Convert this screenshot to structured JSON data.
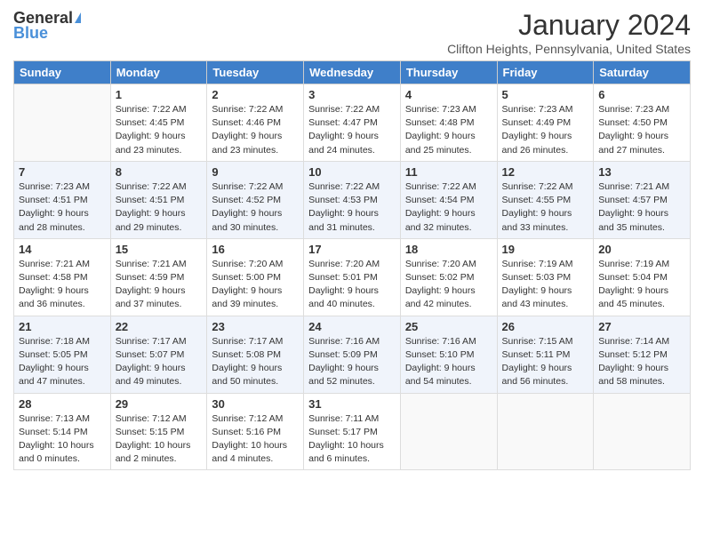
{
  "header": {
    "logo_general": "General",
    "logo_blue": "Blue",
    "month_title": "January 2024",
    "location": "Clifton Heights, Pennsylvania, United States"
  },
  "weekdays": [
    "Sunday",
    "Monday",
    "Tuesday",
    "Wednesday",
    "Thursday",
    "Friday",
    "Saturday"
  ],
  "weeks": [
    [
      {
        "day": "",
        "empty": true
      },
      {
        "day": "1",
        "sunrise": "Sunrise: 7:22 AM",
        "sunset": "Sunset: 4:45 PM",
        "daylight": "Daylight: 9 hours and 23 minutes."
      },
      {
        "day": "2",
        "sunrise": "Sunrise: 7:22 AM",
        "sunset": "Sunset: 4:46 PM",
        "daylight": "Daylight: 9 hours and 23 minutes."
      },
      {
        "day": "3",
        "sunrise": "Sunrise: 7:22 AM",
        "sunset": "Sunset: 4:47 PM",
        "daylight": "Daylight: 9 hours and 24 minutes."
      },
      {
        "day": "4",
        "sunrise": "Sunrise: 7:23 AM",
        "sunset": "Sunset: 4:48 PM",
        "daylight": "Daylight: 9 hours and 25 minutes."
      },
      {
        "day": "5",
        "sunrise": "Sunrise: 7:23 AM",
        "sunset": "Sunset: 4:49 PM",
        "daylight": "Daylight: 9 hours and 26 minutes."
      },
      {
        "day": "6",
        "sunrise": "Sunrise: 7:23 AM",
        "sunset": "Sunset: 4:50 PM",
        "daylight": "Daylight: 9 hours and 27 minutes."
      }
    ],
    [
      {
        "day": "7",
        "sunrise": "Sunrise: 7:23 AM",
        "sunset": "Sunset: 4:51 PM",
        "daylight": "Daylight: 9 hours and 28 minutes."
      },
      {
        "day": "8",
        "sunrise": "Sunrise: 7:22 AM",
        "sunset": "Sunset: 4:51 PM",
        "daylight": "Daylight: 9 hours and 29 minutes."
      },
      {
        "day": "9",
        "sunrise": "Sunrise: 7:22 AM",
        "sunset": "Sunset: 4:52 PM",
        "daylight": "Daylight: 9 hours and 30 minutes."
      },
      {
        "day": "10",
        "sunrise": "Sunrise: 7:22 AM",
        "sunset": "Sunset: 4:53 PM",
        "daylight": "Daylight: 9 hours and 31 minutes."
      },
      {
        "day": "11",
        "sunrise": "Sunrise: 7:22 AM",
        "sunset": "Sunset: 4:54 PM",
        "daylight": "Daylight: 9 hours and 32 minutes."
      },
      {
        "day": "12",
        "sunrise": "Sunrise: 7:22 AM",
        "sunset": "Sunset: 4:55 PM",
        "daylight": "Daylight: 9 hours and 33 minutes."
      },
      {
        "day": "13",
        "sunrise": "Sunrise: 7:21 AM",
        "sunset": "Sunset: 4:57 PM",
        "daylight": "Daylight: 9 hours and 35 minutes."
      }
    ],
    [
      {
        "day": "14",
        "sunrise": "Sunrise: 7:21 AM",
        "sunset": "Sunset: 4:58 PM",
        "daylight": "Daylight: 9 hours and 36 minutes."
      },
      {
        "day": "15",
        "sunrise": "Sunrise: 7:21 AM",
        "sunset": "Sunset: 4:59 PM",
        "daylight": "Daylight: 9 hours and 37 minutes."
      },
      {
        "day": "16",
        "sunrise": "Sunrise: 7:20 AM",
        "sunset": "Sunset: 5:00 PM",
        "daylight": "Daylight: 9 hours and 39 minutes."
      },
      {
        "day": "17",
        "sunrise": "Sunrise: 7:20 AM",
        "sunset": "Sunset: 5:01 PM",
        "daylight": "Daylight: 9 hours and 40 minutes."
      },
      {
        "day": "18",
        "sunrise": "Sunrise: 7:20 AM",
        "sunset": "Sunset: 5:02 PM",
        "daylight": "Daylight: 9 hours and 42 minutes."
      },
      {
        "day": "19",
        "sunrise": "Sunrise: 7:19 AM",
        "sunset": "Sunset: 5:03 PM",
        "daylight": "Daylight: 9 hours and 43 minutes."
      },
      {
        "day": "20",
        "sunrise": "Sunrise: 7:19 AM",
        "sunset": "Sunset: 5:04 PM",
        "daylight": "Daylight: 9 hours and 45 minutes."
      }
    ],
    [
      {
        "day": "21",
        "sunrise": "Sunrise: 7:18 AM",
        "sunset": "Sunset: 5:05 PM",
        "daylight": "Daylight: 9 hours and 47 minutes."
      },
      {
        "day": "22",
        "sunrise": "Sunrise: 7:17 AM",
        "sunset": "Sunset: 5:07 PM",
        "daylight": "Daylight: 9 hours and 49 minutes."
      },
      {
        "day": "23",
        "sunrise": "Sunrise: 7:17 AM",
        "sunset": "Sunset: 5:08 PM",
        "daylight": "Daylight: 9 hours and 50 minutes."
      },
      {
        "day": "24",
        "sunrise": "Sunrise: 7:16 AM",
        "sunset": "Sunset: 5:09 PM",
        "daylight": "Daylight: 9 hours and 52 minutes."
      },
      {
        "day": "25",
        "sunrise": "Sunrise: 7:16 AM",
        "sunset": "Sunset: 5:10 PM",
        "daylight": "Daylight: 9 hours and 54 minutes."
      },
      {
        "day": "26",
        "sunrise": "Sunrise: 7:15 AM",
        "sunset": "Sunset: 5:11 PM",
        "daylight": "Daylight: 9 hours and 56 minutes."
      },
      {
        "day": "27",
        "sunrise": "Sunrise: 7:14 AM",
        "sunset": "Sunset: 5:12 PM",
        "daylight": "Daylight: 9 hours and 58 minutes."
      }
    ],
    [
      {
        "day": "28",
        "sunrise": "Sunrise: 7:13 AM",
        "sunset": "Sunset: 5:14 PM",
        "daylight": "Daylight: 10 hours and 0 minutes."
      },
      {
        "day": "29",
        "sunrise": "Sunrise: 7:12 AM",
        "sunset": "Sunset: 5:15 PM",
        "daylight": "Daylight: 10 hours and 2 minutes."
      },
      {
        "day": "30",
        "sunrise": "Sunrise: 7:12 AM",
        "sunset": "Sunset: 5:16 PM",
        "daylight": "Daylight: 10 hours and 4 minutes."
      },
      {
        "day": "31",
        "sunrise": "Sunrise: 7:11 AM",
        "sunset": "Sunset: 5:17 PM",
        "daylight": "Daylight: 10 hours and 6 minutes."
      },
      {
        "day": "",
        "empty": true
      },
      {
        "day": "",
        "empty": true
      },
      {
        "day": "",
        "empty": true
      }
    ]
  ]
}
